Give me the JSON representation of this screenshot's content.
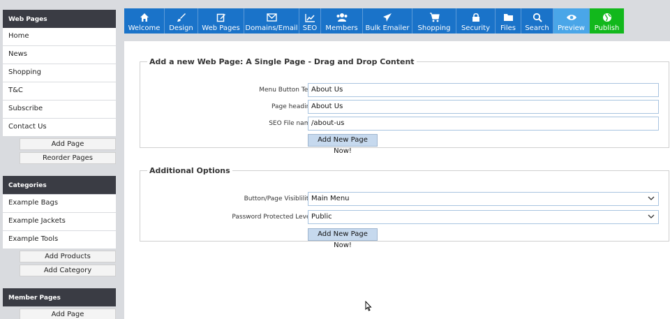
{
  "sidebar": {
    "web_pages": {
      "header": "Web Pages",
      "items": [
        "Home",
        "News",
        "Shopping",
        "T&C",
        "Subscribe",
        "Contact Us"
      ],
      "add_label": "Add Page",
      "reorder_label": "Reorder Pages"
    },
    "categories": {
      "header": "Categories",
      "items": [
        "Example Bags",
        "Example Jackets",
        "Example Tools"
      ],
      "add_products_label": "Add Products",
      "add_category_label": "Add Category"
    },
    "member_pages": {
      "header": "Member Pages",
      "add_label": "Add Page"
    }
  },
  "nav": {
    "items": [
      {
        "label": "Welcome",
        "icon": "home-icon"
      },
      {
        "label": "Design",
        "icon": "brush-icon"
      },
      {
        "label": "Web Pages",
        "icon": "edit-icon"
      },
      {
        "label": "Domains/Email",
        "icon": "envelope-icon"
      },
      {
        "label": "SEO",
        "icon": "chart-icon"
      },
      {
        "label": "Members",
        "icon": "users-icon"
      },
      {
        "label": "Bulk Emailer",
        "icon": "paper-plane-icon"
      },
      {
        "label": "Shopping",
        "icon": "cart-icon"
      },
      {
        "label": "Security",
        "icon": "lock-icon"
      },
      {
        "label": "Files",
        "icon": "folder-icon"
      },
      {
        "label": "Search",
        "icon": "search-icon"
      },
      {
        "label": "Preview",
        "icon": "eye-icon"
      },
      {
        "label": "Publish",
        "icon": "globe-icon"
      }
    ]
  },
  "form1": {
    "legend": "Add a new Web Page: A Single Page - Drag and Drop Content",
    "menu_button_label": "Menu Button Text",
    "menu_button_value": "About Us",
    "page_heading_label": "Page heading",
    "page_heading_value": "About Us",
    "seo_file_label": "SEO File name",
    "seo_file_value": "/about-us",
    "submit_label": "Add New Page Now!"
  },
  "form2": {
    "legend": "Additional Options",
    "visibility_label": "Button/Page Visiblility:",
    "visibility_value": "Main Menu",
    "password_label": "Password Protected Level:",
    "password_value": "Public",
    "submit_label": "Add New Page Now!"
  },
  "colors": {
    "nav_blue": "#1a73c9",
    "preview_blue": "#4aa6e8",
    "publish_green": "#12b81c",
    "sidebar_header": "#3a3c44"
  }
}
